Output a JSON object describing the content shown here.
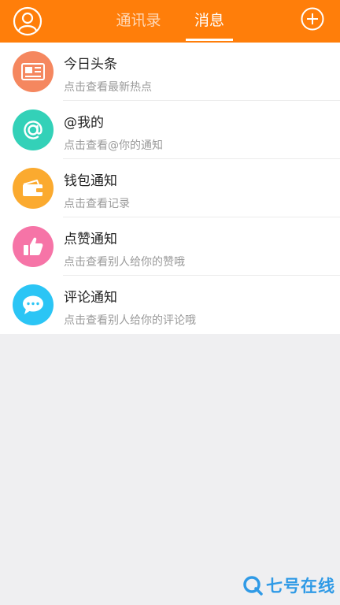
{
  "header": {
    "tabs": [
      {
        "label": "通讯录",
        "active": false
      },
      {
        "label": "消息",
        "active": true
      }
    ],
    "avatar_icon": "user-circle-icon",
    "add_icon": "plus-circle-icon",
    "bg_color": "#ff7e0a"
  },
  "messages": [
    {
      "title": "今日头条",
      "subtitle": "点击查看最新热点",
      "icon": "newspaper-icon",
      "color": "#f5875f"
    },
    {
      "title": "@我的",
      "subtitle": "点击查看@你的通知",
      "icon": "at-sign-icon",
      "color": "#33d1b8"
    },
    {
      "title": "钱包通知",
      "subtitle": "点击查看记录",
      "icon": "wallet-icon",
      "color": "#fbaa2f"
    },
    {
      "title": "点赞通知",
      "subtitle": "点击查看别人给你的赞哦",
      "icon": "thumbs-up-icon",
      "color": "#f674a7"
    },
    {
      "title": "评论通知",
      "subtitle": "点击查看别人给你的评论哦",
      "icon": "comment-bubble-icon",
      "color": "#2bc5f5"
    }
  ],
  "watermark": {
    "text": "七号在线",
    "color": "#2f9ae6"
  }
}
